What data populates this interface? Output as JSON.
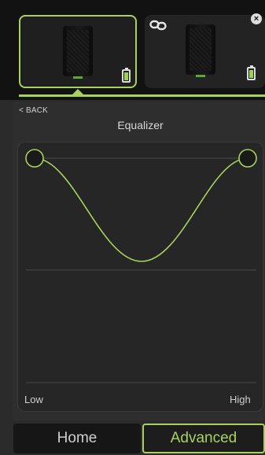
{
  "devices": [
    {
      "name": "speaker-1",
      "selected": true,
      "battery": "high"
    },
    {
      "name": "speaker-2",
      "selected": false,
      "linked": true,
      "battery": "high"
    }
  ],
  "icons": {
    "link": "link-icon",
    "remove": "close-icon",
    "battery": "battery-icon"
  },
  "remove_glyph": "×",
  "navigation": {
    "back_label": "< BACK"
  },
  "panel": {
    "title": "Equalizer"
  },
  "eq": {
    "low_label": "Low",
    "high_label": "High"
  },
  "tabs": {
    "home_label": "Home",
    "advanced_label": "Advanced",
    "active": "Advanced"
  },
  "colors": {
    "accent": "#a9d25c",
    "background": "#2b2b2b",
    "strip": "#121212"
  }
}
